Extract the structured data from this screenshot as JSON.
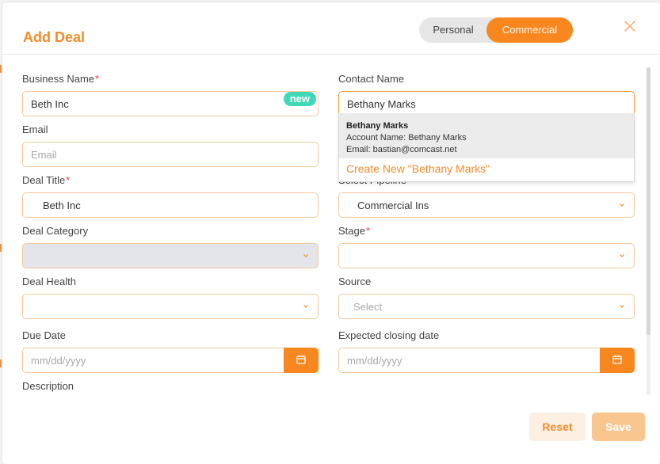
{
  "modal": {
    "title": "Add Deal",
    "toggle": {
      "personal": "Personal",
      "commercial": "Commercial"
    }
  },
  "form": {
    "business_name": {
      "label": "Business Name",
      "value": "Beth Inc",
      "badge": "new"
    },
    "contact_name": {
      "label": "Contact Name",
      "value": "Bethany Marks"
    },
    "email": {
      "label": "Email",
      "placeholder": "Email"
    },
    "deal_title": {
      "label": "Deal Title",
      "value": "Beth Inc"
    },
    "select_pipeline": {
      "label": "Select Pipeline",
      "value": "Commercial Ins"
    },
    "deal_category": {
      "label": "Deal Category"
    },
    "stage": {
      "label": "Stage"
    },
    "deal_health": {
      "label": "Deal Health"
    },
    "source": {
      "label": "Source",
      "placeholder": "Select"
    },
    "due_date": {
      "label": "Due Date",
      "placeholder": "mm/dd/yyyy"
    },
    "expected_closing_date": {
      "label": "Expected closing date",
      "placeholder": "mm/dd/yyyy"
    },
    "description": {
      "label": "Description"
    },
    "required_marker": "*"
  },
  "contact_dropdown": {
    "name": "Bethany Marks",
    "account": "Account Name: Bethany Marks",
    "email": "Email: bastian@comcast.net",
    "create_new": "Create New \"Bethany Marks\""
  },
  "footer": {
    "reset": "Reset",
    "save": "Save"
  },
  "colors": {
    "accent": "#f7871e",
    "badge": "#3fd9b6",
    "required": "#e23b3b"
  }
}
